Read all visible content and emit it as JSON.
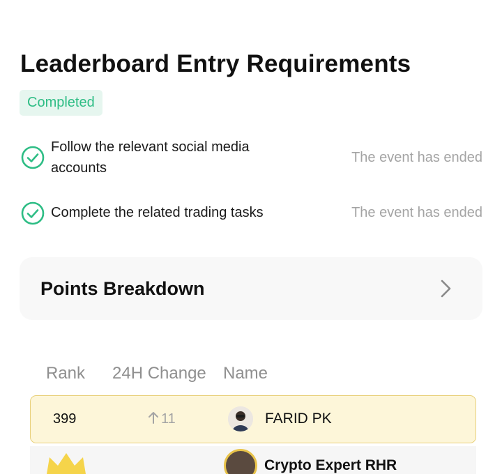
{
  "requirements_section": {
    "title": "Leaderboard Entry Requirements",
    "status_badge": "Completed",
    "items": [
      {
        "text": "Follow the relevant social media accounts",
        "status": "The event has ended"
      },
      {
        "text": "Complete the related trading tasks",
        "status": "The event has ended"
      }
    ]
  },
  "points_breakdown": {
    "label": "Points Breakdown"
  },
  "leaderboard": {
    "columns": [
      "Rank",
      "24H Change",
      "Name"
    ],
    "my_row": {
      "rank": "399",
      "change": "11",
      "change_direction": "up",
      "name": "FARID PK"
    },
    "next_row": {
      "name": "Crypto Expert RHR"
    }
  },
  "colors": {
    "accent_green": "#2ebd85",
    "badge_bg": "#e6f6ef",
    "muted_text": "#a4a4a4",
    "highlight_row_bg": "#fdf6d9",
    "highlight_row_border": "#e8d07a"
  },
  "icons": [
    "check-circle-icon",
    "chevron-right-icon",
    "arrow-up-icon",
    "crown-icon"
  ]
}
